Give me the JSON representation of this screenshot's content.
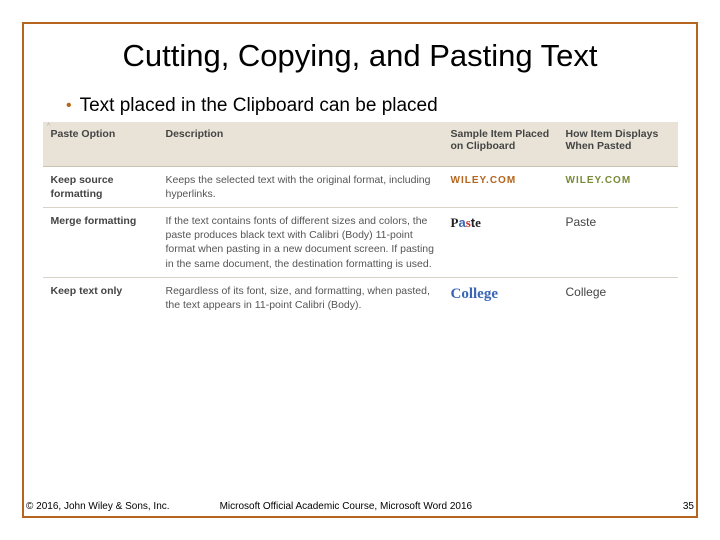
{
  "title": "Cutting, Copying, and Pasting Text",
  "bullet": "Text placed in the Clipboard can be placed",
  "table": {
    "headers": {
      "c1": "Paste Option",
      "c2": "Description",
      "c3": "Sample Item Placed on Clipboard",
      "c4": "How Item Displays When Pasted"
    },
    "rows": [
      {
        "option": "Keep source formatting",
        "desc": "Keeps the selected text with the original format, including hyperlinks.",
        "sample": "WILEY.COM",
        "display": "WILEY.COM"
      },
      {
        "option": "Merge formatting",
        "desc": "If the text contains fonts of different sizes and colors, the paste produces black text with Calibri (Body) 11-point format when pasting in a new document screen. If pasting in the same document, the destination formatting is used.",
        "sample_parts": {
          "p1": "P",
          "p2": "a",
          "p3": "s",
          "p4": "t",
          "p5": "e"
        },
        "display": "Paste"
      },
      {
        "option": "Keep text only",
        "desc": "Regardless of its font, size, and formatting, when pasted, the text appears in 11-point Calibri (Body).",
        "sample": "College",
        "display": "College"
      }
    ],
    "corner": "^"
  },
  "footer": {
    "copyright": "© 2016, John Wiley & Sons, Inc.",
    "course": "Microsoft Official Academic Course, Microsoft Word 2016",
    "page": "35"
  }
}
